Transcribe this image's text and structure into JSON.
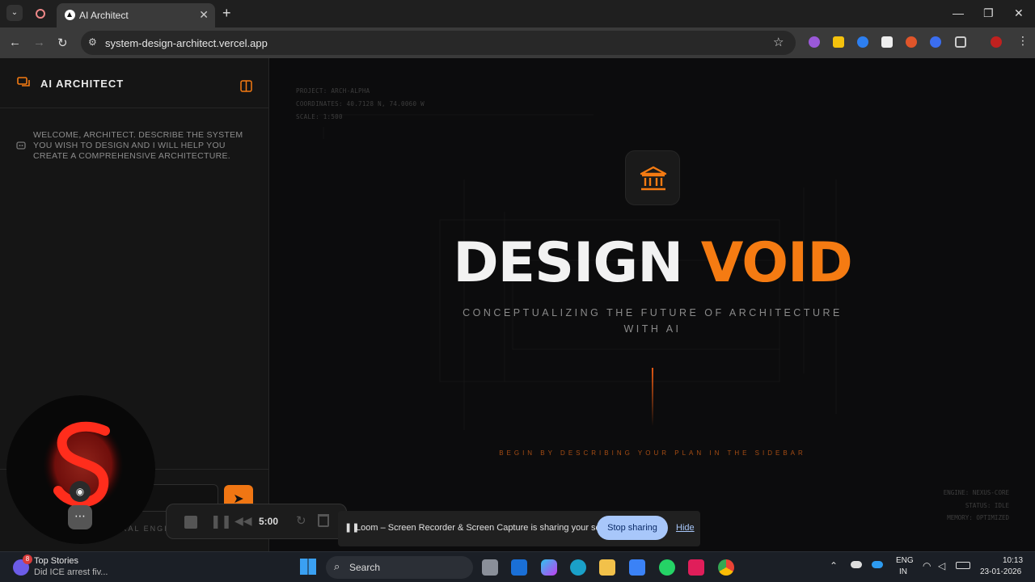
{
  "browser": {
    "tab_title": "AI Architect",
    "url": "system-design-architect.vercel.app"
  },
  "sidebar": {
    "brand": "AI ARCHITECT",
    "welcome": "WELCOME, ARCHITECT. DESCRIBE THE SYSTEM YOU WISH TO DESIGN AND I WILL HELP YOU CREATE A COMPREHENSIVE ARCHITECTURE.",
    "footer_fragment": "RAL ENGI"
  },
  "main": {
    "meta": {
      "project": "PROJECT: ARCH-ALPHA",
      "coordinates": "COORDINATES: 40.7128 N, 74.0060 W",
      "scale": "SCALE: 1:500"
    },
    "hero_white": "DESIGN",
    "hero_orange": "VOID",
    "subtitle": "CONCEPTUALIZING THE FUTURE OF ARCHITECTURE WITH AI",
    "cta": "BEGIN BY DESCRIBING YOUR PLAN IN THE SIDEBAR",
    "status": {
      "engine": "ENGINE: NEXUS-CORE",
      "status": "STATUS: IDLE",
      "memory": "MEMORY: OPTIMIZED"
    }
  },
  "recorder": {
    "time": "5:00"
  },
  "share_banner": {
    "text": "Loom – Screen Recorder & Screen Capture is sharing your screen.",
    "stop": "Stop sharing",
    "hide": "Hide"
  },
  "taskbar": {
    "news_badge": "8",
    "news_title": "Top Stories",
    "news_sub": "Did ICE arrest fiv...",
    "search": "Search",
    "lang1": "ENG",
    "lang2": "IN",
    "time": "10:13",
    "date": "23-01-2026"
  },
  "colors": {
    "accent": "#f57b12",
    "hero_white": "#f2f2f2"
  }
}
